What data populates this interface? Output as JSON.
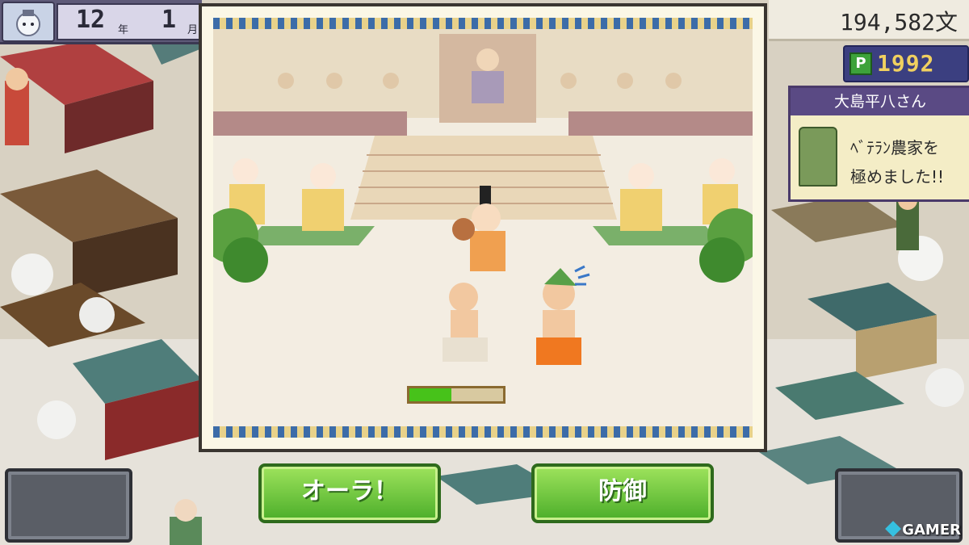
{
  "hud": {
    "year_num": "12",
    "year_unit": "年",
    "month_num": "1",
    "month_unit": "月",
    "money": "194,582文",
    "points_icon": "P",
    "points": "1992"
  },
  "notification": {
    "name": "大島平八さん",
    "line1": "ﾍﾞﾃﾗﾝ農家を",
    "line2": "極めました!!"
  },
  "battle": {
    "health_fraction": 0.45
  },
  "actions": {
    "attack_label": "オーラ！",
    "defend_label": "防御"
  },
  "watermark": "GAMER",
  "colors": {
    "button_green": "#4cae2a",
    "health_green": "#47c21a",
    "points_gold": "#f0d060"
  }
}
